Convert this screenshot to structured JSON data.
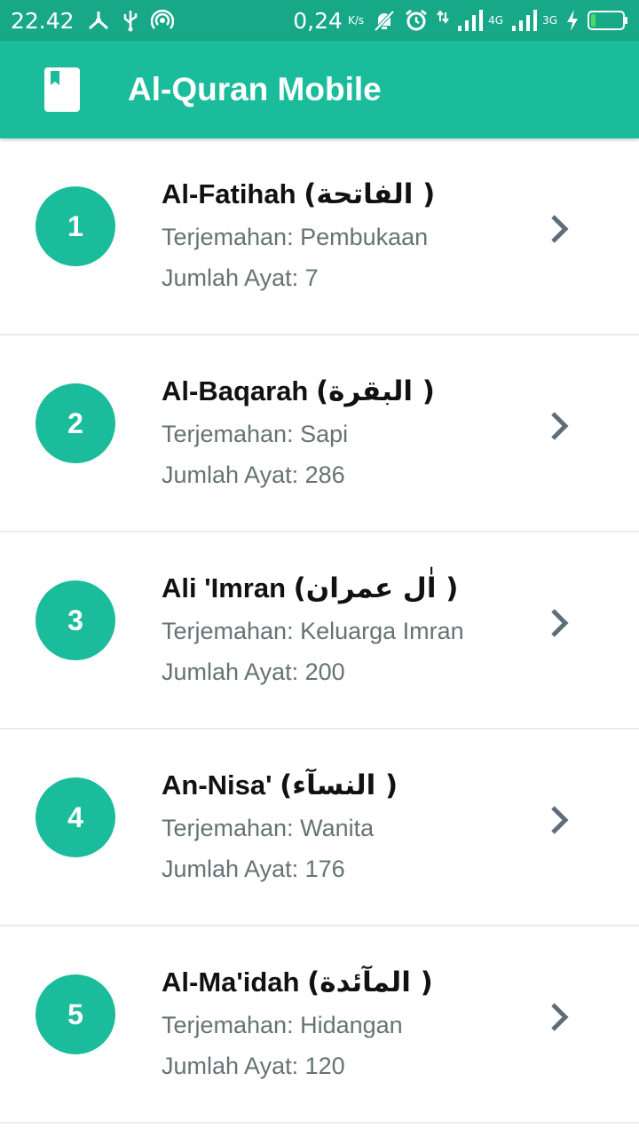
{
  "status_bar": {
    "time": "22.42",
    "speed": "0,24",
    "speed_unit": "K/s",
    "net1": "4G",
    "net2": "3G",
    "icons": [
      "nodes-icon",
      "usb-icon",
      "hotspot-icon",
      "mute-icon",
      "alarm-icon",
      "data-arrows-icon",
      "signal-icon",
      "signal-icon",
      "charging-icon",
      "battery-icon"
    ],
    "battery_level": 0.15
  },
  "app_bar": {
    "title": "Al-Quran Mobile",
    "icon": "book-icon"
  },
  "surahs": [
    {
      "number": "1",
      "name": "Al-Fatihah",
      "arabic": "( الفاتحة)",
      "translation": "Terjemahan: Pembukaan",
      "ayat": "Jumlah Ayat: 7"
    },
    {
      "number": "2",
      "name": "Al-Baqarah",
      "arabic": "( البقرة)",
      "translation": "Terjemahan: Sapi",
      "ayat": "Jumlah Ayat: 286"
    },
    {
      "number": "3",
      "name": "Ali 'Imran",
      "arabic": "( اٰل عمران)",
      "translation": "Terjemahan: Keluarga Imran",
      "ayat": "Jumlah Ayat: 200"
    },
    {
      "number": "4",
      "name": "An-Nisa'",
      "arabic": "( النسآء)",
      "translation": "Terjemahan: Wanita",
      "ayat": "Jumlah Ayat: 176"
    },
    {
      "number": "5",
      "name": "Al-Ma'idah",
      "arabic": "( المآئدة)",
      "translation": "Terjemahan: Hidangan",
      "ayat": "Jumlah Ayat: 120"
    }
  ],
  "colors": {
    "status_bar": "#17a888",
    "primary": "#1bbc9b",
    "subtitle": "#667373",
    "chevron": "#5f6d78"
  }
}
